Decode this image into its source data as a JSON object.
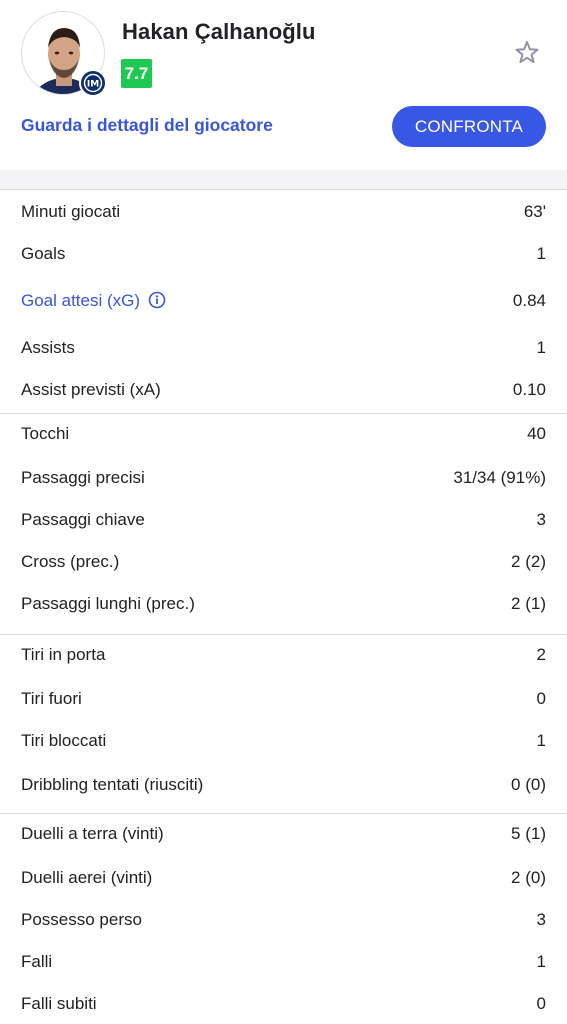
{
  "player": {
    "name": "Hakan Çalhanoğlu",
    "rating": "7.7",
    "details_link": "Guarda i dettagli del giocatore",
    "compare_button": "CONFRONTA",
    "rating_color": "#1ec853",
    "accent_color": "#3857e5",
    "favorite_icon": "star-outline-icon",
    "team_badge_icon": "inter-crest-icon"
  },
  "stats": {
    "group1": [
      {
        "label": "Minuti giocati",
        "value": "63'"
      },
      {
        "label": "Goals",
        "value": "1"
      },
      {
        "label": "Goal attesi (xG)",
        "value": "0.84"
      },
      {
        "label": "Assists",
        "value": "1"
      },
      {
        "label": "Assist previsti (xA)",
        "value": "0.10"
      }
    ],
    "group2": [
      {
        "label": "Tocchi",
        "value": "40"
      },
      {
        "label": "Passaggi precisi",
        "value": "31/34 (91%)"
      },
      {
        "label": "Passaggi chiave",
        "value": "3"
      },
      {
        "label": "Cross (prec.)",
        "value": "2 (2)"
      },
      {
        "label": "Passaggi lunghi (prec.)",
        "value": "2 (1)"
      }
    ],
    "group3": [
      {
        "label": "Tiri in porta",
        "value": "2"
      },
      {
        "label": "Tiri fuori",
        "value": "0"
      },
      {
        "label": "Tiri bloccati",
        "value": "1"
      },
      {
        "label": "Dribbling tentati (riusciti)",
        "value": "0 (0)"
      }
    ],
    "group4": [
      {
        "label": "Duelli a terra (vinti)",
        "value": "5 (1)"
      },
      {
        "label": "Duelli aerei (vinti)",
        "value": "2 (0)"
      },
      {
        "label": "Possesso perso",
        "value": "3"
      },
      {
        "label": "Falli",
        "value": "1"
      },
      {
        "label": "Falli subiti",
        "value": "0"
      }
    ]
  }
}
